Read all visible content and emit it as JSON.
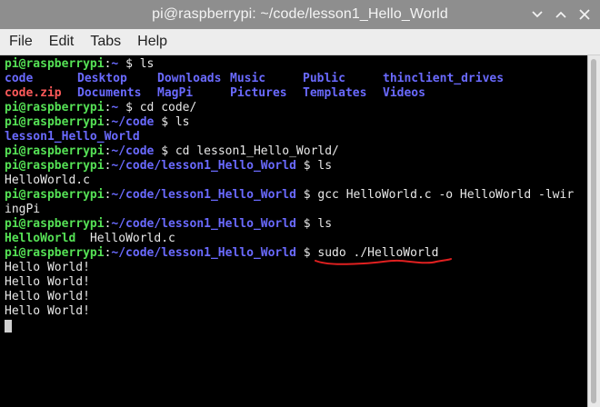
{
  "window": {
    "title": "pi@raspberrypi: ~/code/lesson1_Hello_World",
    "controls": {
      "minimize_icon": "chevron-down-icon",
      "maximize_icon": "chevron-up-icon",
      "close_icon": "close-icon"
    }
  },
  "menu": {
    "file": "File",
    "edit": "Edit",
    "tabs": "Tabs",
    "help": "Help"
  },
  "colors": {
    "user_host": "#55e155",
    "path": "#6a6aff",
    "executable": "#55e155",
    "archive": "#ff5a5a",
    "annotation": "#e02020"
  },
  "terminal": {
    "prompt_user": "pi@raspberrypi",
    "sep": ":",
    "dollar": "$",
    "cmd1": {
      "path": "~",
      "command": "ls"
    },
    "ls_home": {
      "row1": [
        "code",
        "Desktop",
        "Downloads",
        "Music",
        "Public",
        "thinclient_drives"
      ],
      "row2": [
        "code.zip",
        "Documents",
        "MagPi",
        "Pictures",
        "Templates",
        "Videos"
      ]
    },
    "cmd2": {
      "path": "~",
      "command": "cd code/"
    },
    "cmd3": {
      "path": "~/code",
      "command": "ls"
    },
    "out3": "lesson1_Hello_World",
    "cmd4": {
      "path": "~/code",
      "command": "cd lesson1_Hello_World/"
    },
    "cmd5": {
      "path": "~/code/lesson1_Hello_World",
      "command": "ls"
    },
    "out5": "HelloWorld.c",
    "cmd6": {
      "path": "~/code/lesson1_Hello_World",
      "command": "gcc HelloWorld.c -o HelloWorld -lwir"
    },
    "cmd6_wrap": "ingPi",
    "cmd7": {
      "path": "~/code/lesson1_Hello_World",
      "command": "ls"
    },
    "out7": {
      "executable": "HelloWorld",
      "source": "HelloWorld.c"
    },
    "cmd8": {
      "path": "~/code/lesson1_Hello_World",
      "command": "sudo ./HelloWorld"
    },
    "output": [
      "Hello World!",
      "Hello World!",
      "Hello World!",
      "Hello World!"
    ]
  }
}
